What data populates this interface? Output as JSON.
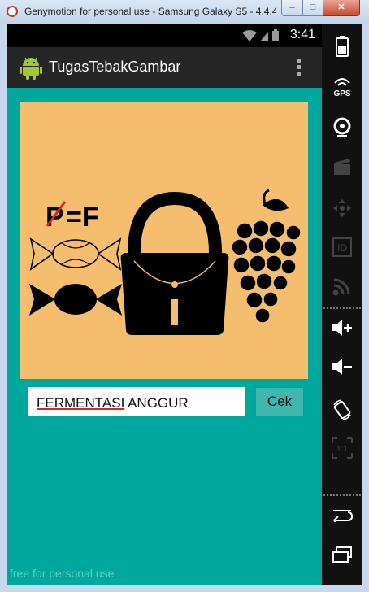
{
  "window": {
    "title": "Genymotion for personal use - Samsung Galaxy S5 - 4.4.4...",
    "minimize_label": "–",
    "maximize_label": "□",
    "close_label": "✕"
  },
  "statusbar": {
    "time": "3:41"
  },
  "actionbar": {
    "title": "TugasTebakGambar",
    "overflow_icon": "overflow-menu-icon"
  },
  "puzzle": {
    "rebus_text_crossed": "P",
    "rebus_text_rest": "=F",
    "images": [
      "candy-icon",
      "bag-icon",
      "grapes-icon"
    ]
  },
  "answer_field": {
    "value_part1": "FERMENTASI",
    "value_part2": " ANGGUR"
  },
  "check_button": {
    "label": "Cek"
  },
  "watermark": "free for personal use",
  "toolbar": [
    "battery-icon",
    "gps-icon",
    "camera-icon",
    "clapper-icon",
    "dpad-icon",
    "id-icon",
    "cast-icon",
    "volume-up-icon",
    "volume-down-icon",
    "rotate-icon",
    "pixel-scale-icon",
    "back-icon",
    "recents-icon"
  ],
  "toolbar_labels": {
    "gps": "GPS",
    "id": "ID",
    "scale": "1:1"
  },
  "colors": {
    "app_background": "#00a79d",
    "picture_background": "#f4be6e",
    "button": "#3fb7ae",
    "action_bar": "#262626"
  }
}
